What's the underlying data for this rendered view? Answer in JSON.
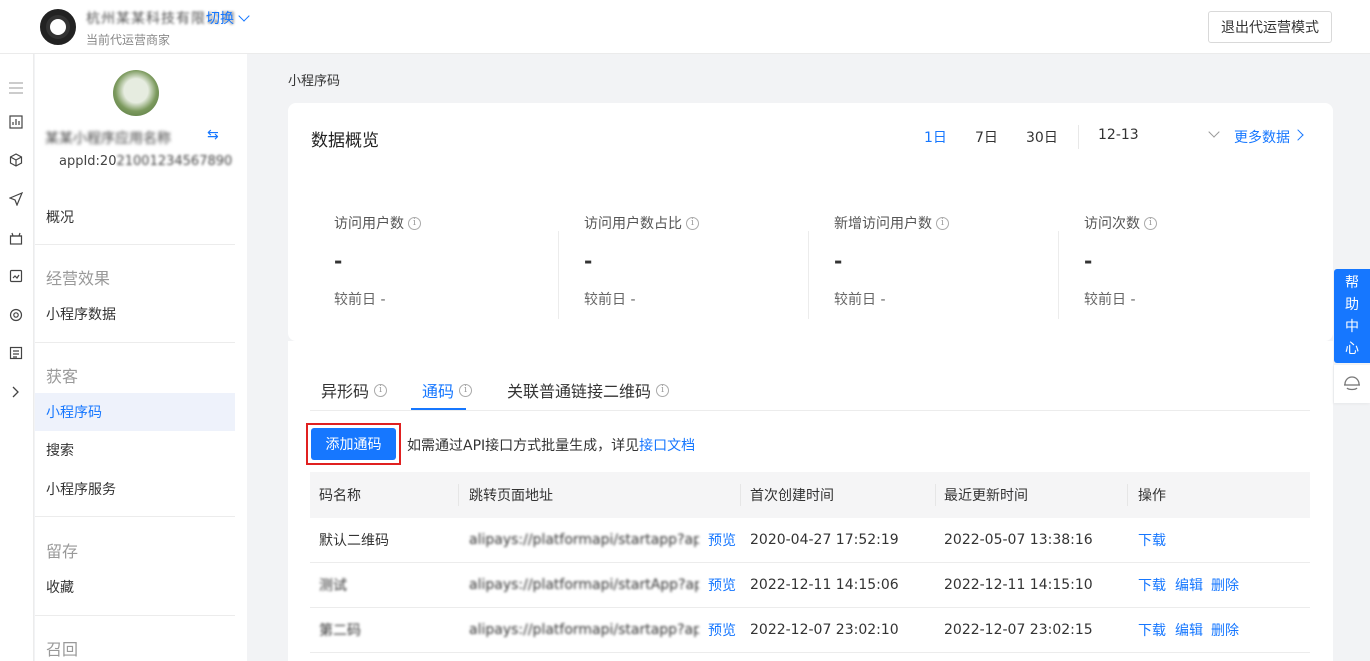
{
  "topbar": {
    "merchant_name": "杭州某某科技有限公司",
    "switch_label": "切换",
    "merchant_subtitle": "当前代运营商家",
    "exit_label": "退出代运营模式"
  },
  "rail": {
    "icons": [
      "menu-icon",
      "chart-icon",
      "cube-icon",
      "send-icon",
      "gift-icon",
      "shop-icon",
      "target-icon",
      "document-icon",
      "chevron-right-icon"
    ]
  },
  "sidebar": {
    "app_name": "某某小程序应用名称",
    "app_id_prefix": "appId:20",
    "app_id_masked": "21001234567890",
    "items": [
      {
        "label": "概况"
      },
      {
        "group": "经营效果"
      },
      {
        "label": "小程序数据"
      },
      {
        "group": "获客"
      },
      {
        "label": "小程序码",
        "active": true
      },
      {
        "label": "搜索"
      },
      {
        "label": "小程序服务"
      },
      {
        "group": "留存"
      },
      {
        "label": "收藏"
      },
      {
        "group": "召回"
      }
    ]
  },
  "breadcrumb": "小程序码",
  "overview": {
    "title": "数据概览",
    "ranges": [
      "1日",
      "7日",
      "30日"
    ],
    "active_range": "1日",
    "date": "12-13",
    "more_label": "更多数据",
    "metrics": [
      {
        "label": "访问用户数",
        "value": "-",
        "compare": "较前日 -"
      },
      {
        "label": "访问用户数占比",
        "value": "-",
        "compare": "较前日 -"
      },
      {
        "label": "新增访问用户数",
        "value": "-",
        "compare": "较前日 -"
      },
      {
        "label": "访问次数",
        "value": "-",
        "compare": "较前日 -"
      }
    ]
  },
  "codes": {
    "tabs": [
      "异形码",
      "通码",
      "关联普通链接二维码"
    ],
    "active_tab": "通码",
    "add_label": "添加通码",
    "hint_text": "如需通过API接口方式批量生成，详见",
    "hint_link": "接口文档",
    "columns": [
      "码名称",
      "跳转页面地址",
      "首次创建时间",
      "最近更新时间",
      "操作"
    ],
    "rows": [
      {
        "name": "默认二维码",
        "url": "alipays://platformapi/startapp?appId...",
        "preview": "预览",
        "created": "2020-04-27 17:52:19",
        "updated": "2022-05-07 13:38:16",
        "actions": [
          "下载"
        ]
      },
      {
        "name": "测试",
        "url": "alipays://platformapi/startApp?appId...",
        "preview": "预览",
        "created": "2022-12-11 14:15:06",
        "updated": "2022-12-11 14:15:10",
        "actions": [
          "下载",
          "编辑",
          "删除"
        ]
      },
      {
        "name": "第二码",
        "url": "alipays://platformapi/startapp?appId...",
        "preview": "预览",
        "created": "2022-12-07 23:02:10",
        "updated": "2022-12-07 23:02:15",
        "actions": [
          "下载",
          "编辑",
          "删除"
        ]
      }
    ]
  },
  "help": {
    "label_chars": [
      "帮",
      "助",
      "中",
      "心"
    ]
  }
}
